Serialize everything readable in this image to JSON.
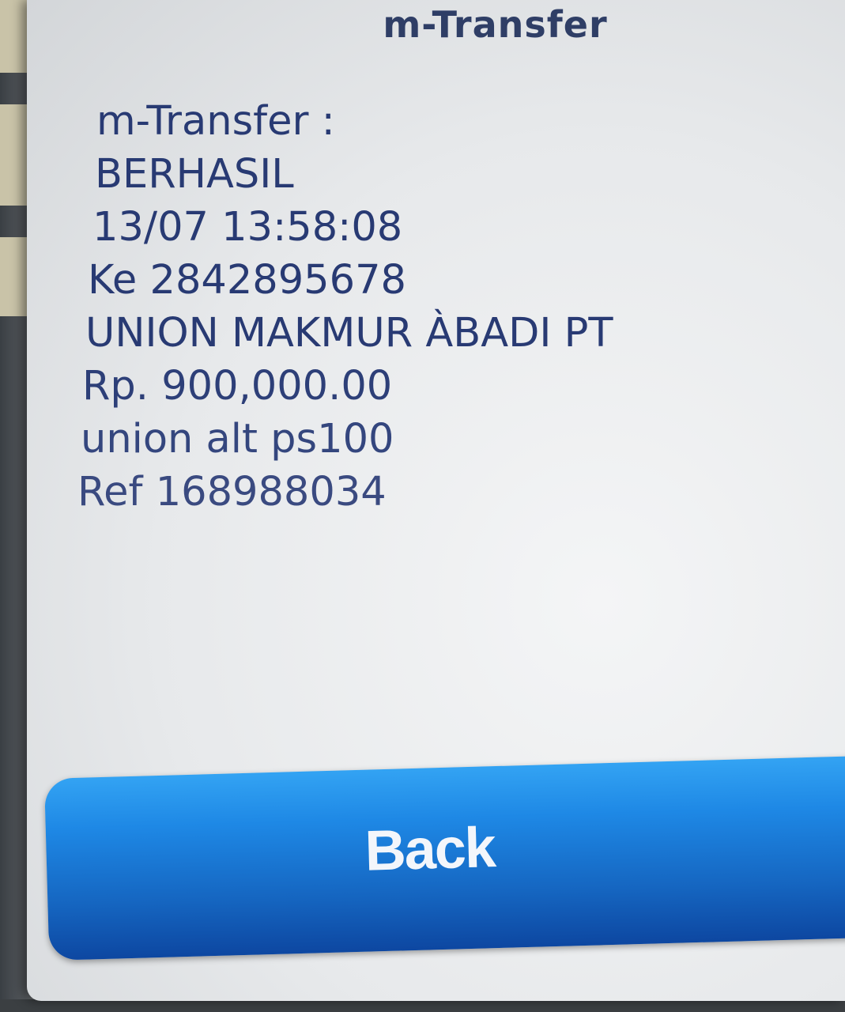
{
  "header": {
    "title": "m-Transfer"
  },
  "message": {
    "lines": [
      "m-Transfer :",
      "BERHASIL",
      "13/07 13:58:08",
      "Ke 2842895678",
      "UNION MAKMUR ÀBADI PT",
      "Rp. 900,000.00",
      "union alt ps100",
      "Ref 168988034"
    ]
  },
  "actions": {
    "back_label": "Back"
  },
  "colors": {
    "title_text": "#2f3e66",
    "message_text": "#283a73",
    "button_top": "#33a3f3",
    "button_bottom": "#0d47a1",
    "button_text": "#f3f6fb"
  }
}
